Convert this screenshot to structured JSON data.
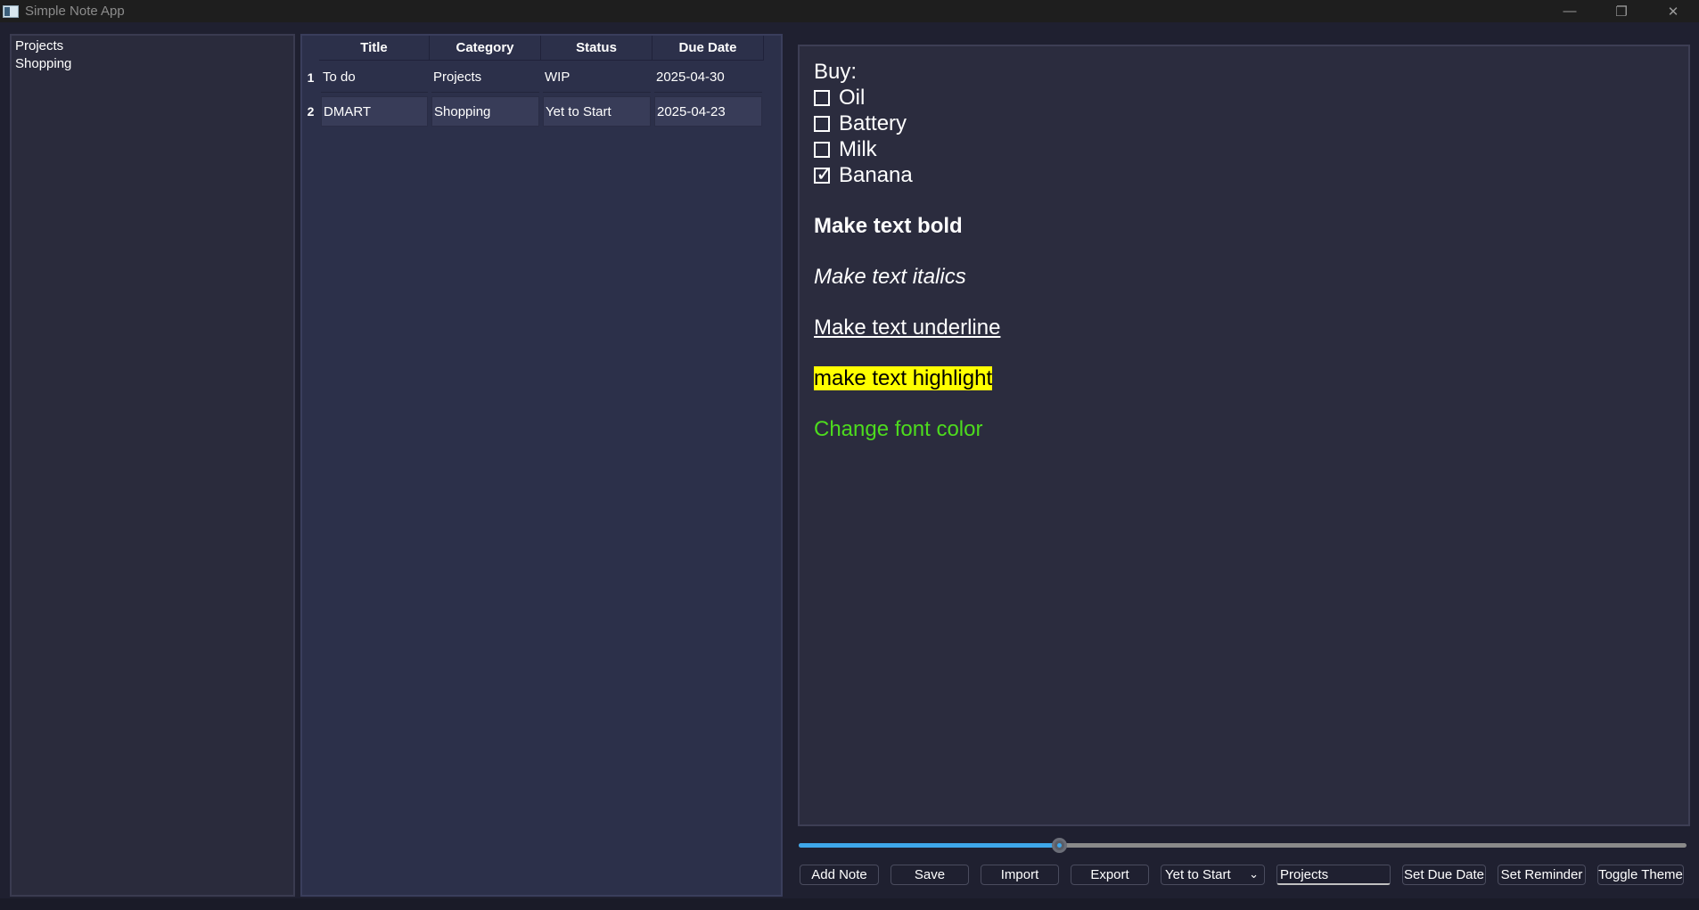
{
  "window": {
    "title": "Simple Note App",
    "controls": {
      "minimize": "—",
      "maximize": "❐",
      "close": "✕"
    }
  },
  "categories": [
    "Projects",
    "Shopping"
  ],
  "table": {
    "headers": [
      "Title",
      "Category",
      "Status",
      "Due Date"
    ],
    "rows": [
      {
        "num": "1",
        "title": "To do",
        "category": "Projects",
        "status": "WIP",
        "due": "2025-04-30"
      },
      {
        "num": "2",
        "title": "DMART",
        "category": "Shopping",
        "status": "Yet to Start",
        "due": "2025-04-23"
      }
    ]
  },
  "editor": {
    "heading": "Buy:",
    "checklist": [
      {
        "label": "Oil",
        "checked": false
      },
      {
        "label": "Battery",
        "checked": false
      },
      {
        "label": "Milk",
        "checked": false
      },
      {
        "label": "Banana",
        "checked": true
      }
    ],
    "bold_text": "Make text bold",
    "italic_text": "Make text italics",
    "underline_text": "Make text underline",
    "highlight_text": "make text highlight",
    "color_text": "Change font color",
    "highlight_color": "#ffff00",
    "font_color": "#4ddb1e"
  },
  "slider": {
    "value_fraction": 0.293
  },
  "toolbar": {
    "add_note": "Add Note",
    "save": "Save",
    "import": "Import",
    "export": "Export",
    "status_selected": "Yet to Start",
    "category_value": "Projects",
    "set_due_date": "Set Due Date",
    "set_reminder": "Set Reminder",
    "toggle_theme": "Toggle Theme"
  },
  "colors": {
    "accent": "#3ea7ea",
    "background": "#1f2030",
    "panel": "#2c304a"
  }
}
